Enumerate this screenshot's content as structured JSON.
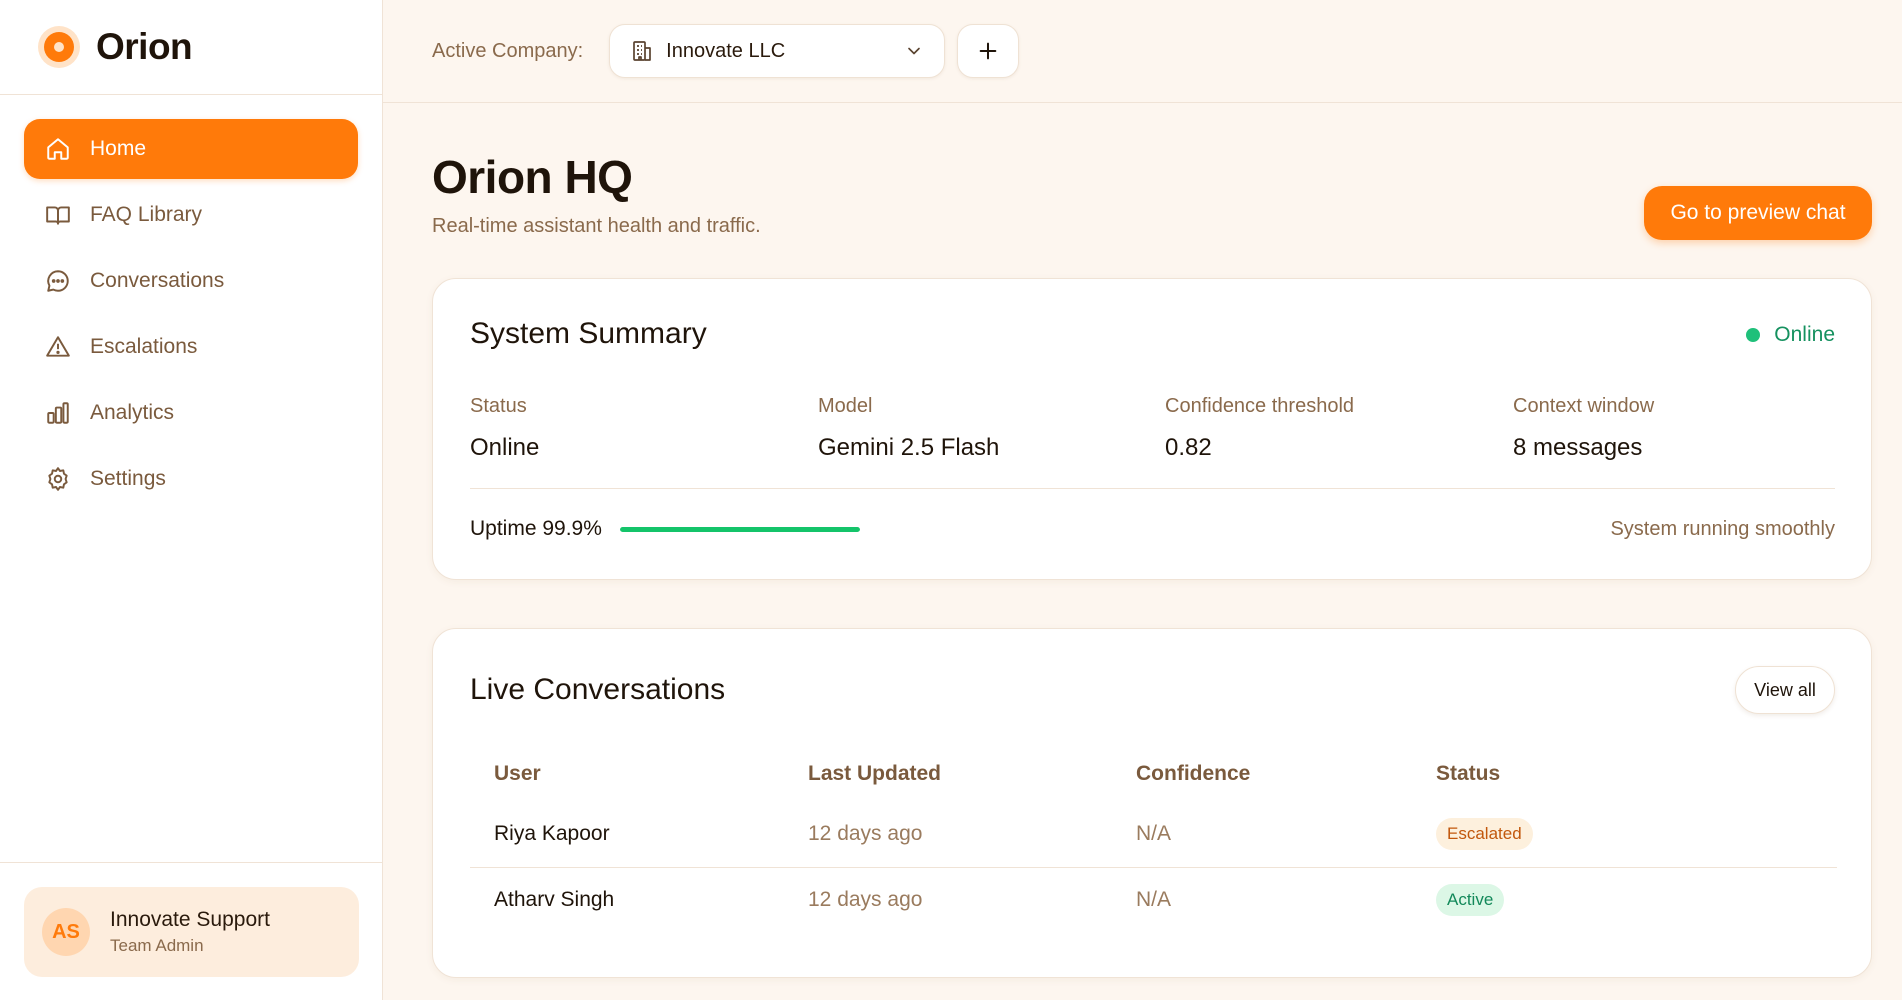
{
  "app": {
    "name": "Orion",
    "accent": "#ff7a0a"
  },
  "sidebar": {
    "items": [
      {
        "label": "Home",
        "icon": "home-icon",
        "active": true
      },
      {
        "label": "FAQ Library",
        "icon": "book-icon",
        "active": false
      },
      {
        "label": "Conversations",
        "icon": "chat-bubble-icon",
        "active": false
      },
      {
        "label": "Escalations",
        "icon": "warning-icon",
        "active": false
      },
      {
        "label": "Analytics",
        "icon": "bar-chart-icon",
        "active": false
      },
      {
        "label": "Settings",
        "icon": "gear-icon",
        "active": false
      }
    ],
    "profile": {
      "initials": "AS",
      "name": "Innovate Support",
      "role": "Team Admin"
    }
  },
  "topbar": {
    "company_label": "Active Company:",
    "company_value": "Innovate LLC",
    "add_icon": "plus-icon"
  },
  "page": {
    "title": "Orion HQ",
    "subtitle": "Real-time assistant health and traffic.",
    "preview_button": "Go to preview chat"
  },
  "summary": {
    "title": "System Summary",
    "status_pill": "Online",
    "stats": [
      {
        "label": "Status",
        "value": "Online"
      },
      {
        "label": "Model",
        "value": "Gemini 2.5 Flash"
      },
      {
        "label": "Confidence threshold",
        "value": "0.82"
      },
      {
        "label": "Context window",
        "value": "8 messages"
      }
    ],
    "uptime_label": "Uptime 99.9%",
    "uptime_fraction": 0.999,
    "health_text": "System running smoothly"
  },
  "live": {
    "title": "Live Conversations",
    "view_all": "View all",
    "columns": [
      "User",
      "Last Updated",
      "Confidence",
      "Status"
    ],
    "rows": [
      {
        "user": "Riya Kapoor",
        "updated": "12 days ago",
        "confidence": "N/A",
        "status": "Escalated",
        "status_color": "#c2570c"
      },
      {
        "user": "Atharv Singh",
        "updated": "12 days ago",
        "confidence": "N/A",
        "status": "Active",
        "status_color": "#13895a"
      }
    ]
  }
}
